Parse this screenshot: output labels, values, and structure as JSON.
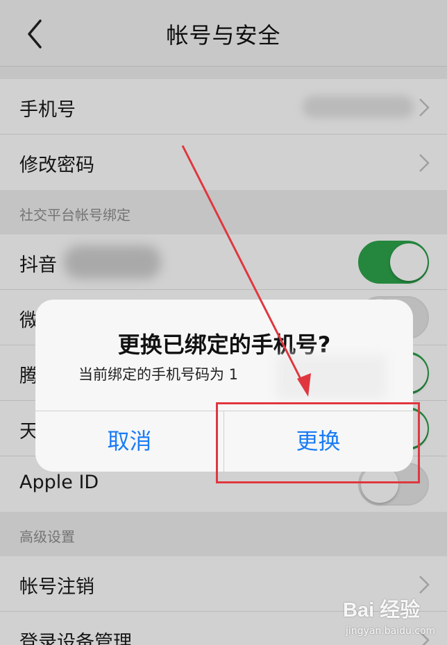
{
  "navbar": {
    "title": "帐号与安全",
    "back_icon": "chevron-left-icon"
  },
  "account_section": {
    "phone_label": "手机号",
    "password_label": "修改密码"
  },
  "social_section": {
    "header": "社交平台帐号绑定",
    "items": [
      {
        "label": "抖音",
        "enabled": true
      },
      {
        "label": "微",
        "enabled": false
      },
      {
        "label": "腾",
        "enabled": true
      },
      {
        "label": "天",
        "enabled": true
      },
      {
        "label": "Apple ID",
        "enabled": false
      }
    ]
  },
  "advanced_section": {
    "header": "高级设置",
    "deactivate_label": "帐号注销",
    "devices_label": "登录设备管理"
  },
  "dialog": {
    "title": "更换已绑定的手机号?",
    "message": "当前绑定的手机号码为 1",
    "cancel_label": "取消",
    "confirm_label": "更换"
  },
  "watermark": {
    "logo": "Bai 经验",
    "url": "jingyan.baidu.com"
  },
  "colors": {
    "toggle_on": "#2ea54c",
    "dialog_button": "#1b7cf5",
    "annotation_red": "#e0373f"
  }
}
